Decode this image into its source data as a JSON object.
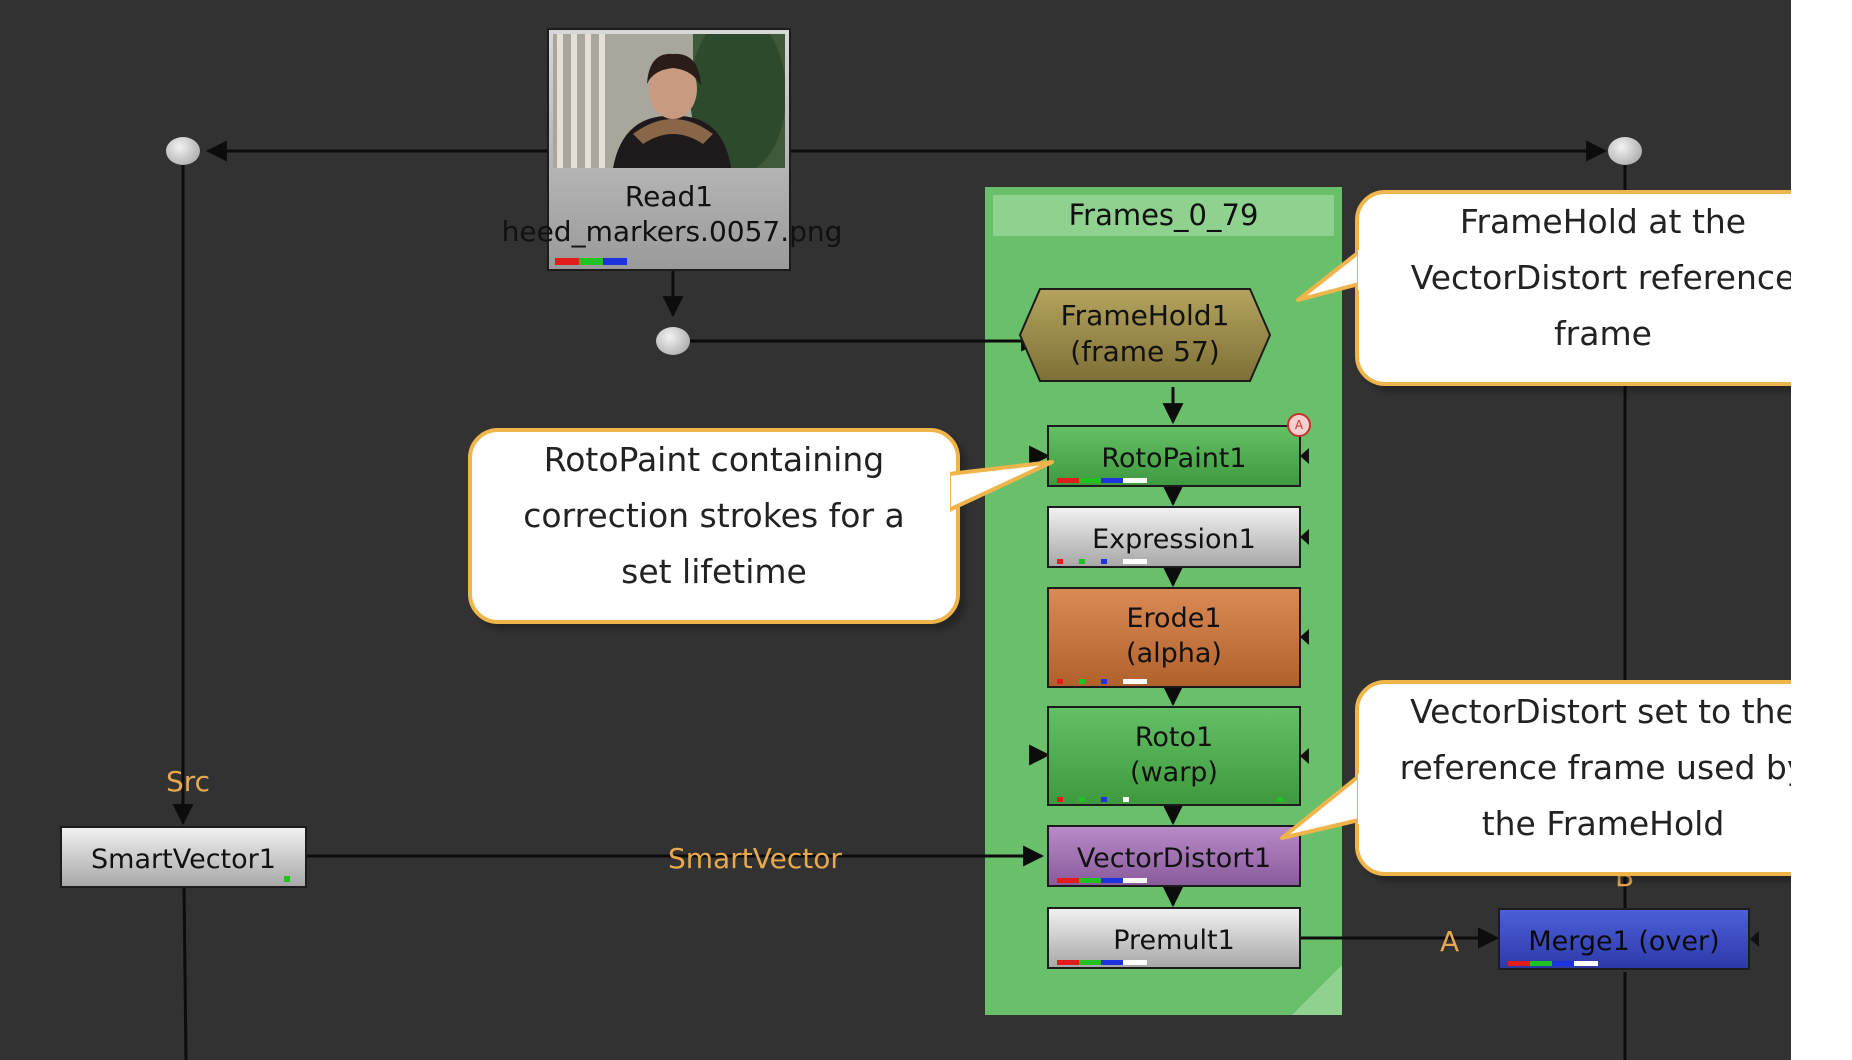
{
  "colors": {
    "graph_bg": "#323232",
    "backdrop": "#6ac06a",
    "callout_border": "#f0b54a",
    "label_orange": "#e8a94e",
    "read_node": "#b4b4b4",
    "rotopaint_node": "#4fae4f",
    "erode_node": "#c47443",
    "vectordistort_node": "#a375b5",
    "merge_node": "#3b4bc4",
    "framehold_node": "#9a8a4a"
  },
  "read_node": {
    "name": "Read1",
    "file": "heed_markers.0057.png",
    "thumbnail": "woman-in-fur-collar-coat"
  },
  "backdrop": {
    "title": "Frames_0_79"
  },
  "nodes": {
    "framehold": {
      "line1": "FrameHold1",
      "line2": "(frame 57)"
    },
    "rotopaint": {
      "line1": "RotoPaint1",
      "badge_icon": "warning-badge-icon"
    },
    "expression": {
      "line1": "Expression1"
    },
    "erode": {
      "line1": "Erode1",
      "line2": "(alpha)"
    },
    "roto": {
      "line1": "Roto1",
      "line2": "(warp)"
    },
    "vectordistort": {
      "line1": "VectorDistort1"
    },
    "premult": {
      "line1": "Premult1"
    },
    "merge": {
      "line1": "Merge1 (over)"
    },
    "smartvector": {
      "line1": "SmartVector1"
    }
  },
  "input_labels": {
    "src": "Src",
    "smartvector": "SmartVector",
    "a": "A",
    "b": "B"
  },
  "callouts": {
    "framehold": [
      "FrameHold at the",
      "VectorDistort reference",
      "frame"
    ],
    "rotopaint": [
      "RotoPaint containing",
      "correction strokes for a",
      "set lifetime"
    ],
    "vectordistort": [
      "VectorDistort set to the",
      "reference frame used by",
      "the FrameHold"
    ]
  }
}
